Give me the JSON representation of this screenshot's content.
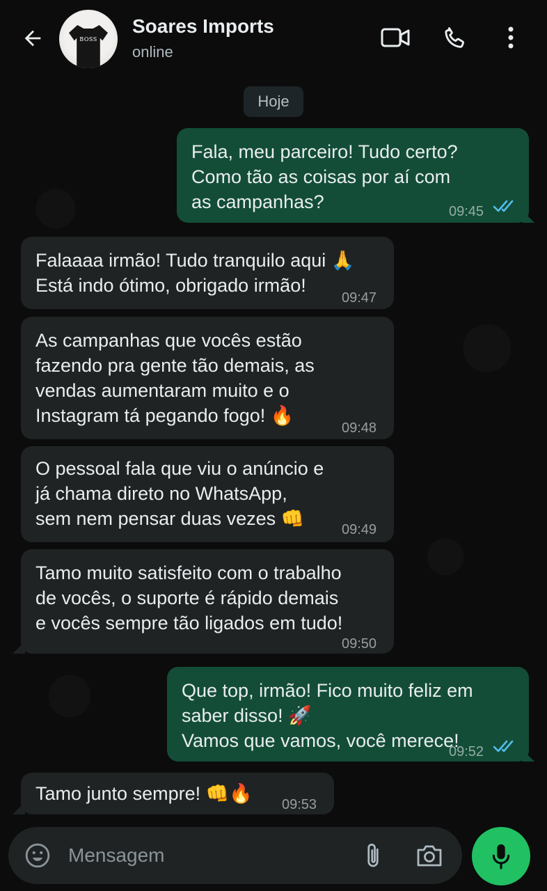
{
  "header": {
    "contact_name": "Soares Imports",
    "status": "online",
    "avatar_brand": "BOSS"
  },
  "date_separator": "Hoje",
  "messages": [
    {
      "direction": "out",
      "text": "Fala, meu parceiro! Tudo certo?\nComo tão as coisas por aí com\nas campanhas?",
      "time": "09:45",
      "read": true
    },
    {
      "direction": "in",
      "text": "Falaaaa irmão! Tudo tranquilo aqui 🙏\nEstá indo ótimo, obrigado irmão!",
      "time": "09:47"
    },
    {
      "direction": "in",
      "text": "As campanhas que vocês estão\nfazendo pra gente tão demais, as\nvendas aumentaram muito e o\nInstagram tá pegando fogo! 🔥",
      "time": "09:48"
    },
    {
      "direction": "in",
      "text": "O pessoal fala que viu o anúncio e\njá chama direto no WhatsApp,\nsem nem pensar duas vezes 👊",
      "time": "09:49"
    },
    {
      "direction": "in",
      "text": "Tamo muito satisfeito com o trabalho\nde vocês, o suporte é rápido demais\ne vocês sempre tão ligados em tudo!",
      "time": "09:50"
    },
    {
      "direction": "out",
      "text": "Que top, irmão! Fico muito feliz em\nsaber disso! 🚀\nVamos que vamos, você merece!",
      "time": "09:52",
      "read": true
    },
    {
      "direction": "in",
      "text": "Tamo junto sempre! 👊🔥",
      "time": "09:53"
    }
  ],
  "composer": {
    "placeholder": "Mensagem"
  },
  "colors": {
    "background": "#0b0c0b",
    "incoming_bubble": "#1f2324",
    "outgoing_bubble": "#134d37",
    "read_ticks": "#53bdeb",
    "mic_button": "#21c063"
  },
  "icons": [
    "back-arrow-icon",
    "video-call-icon",
    "phone-icon",
    "more-options-icon",
    "emoji-icon",
    "attach-icon",
    "camera-icon",
    "mic-icon",
    "double-check-icon"
  ]
}
